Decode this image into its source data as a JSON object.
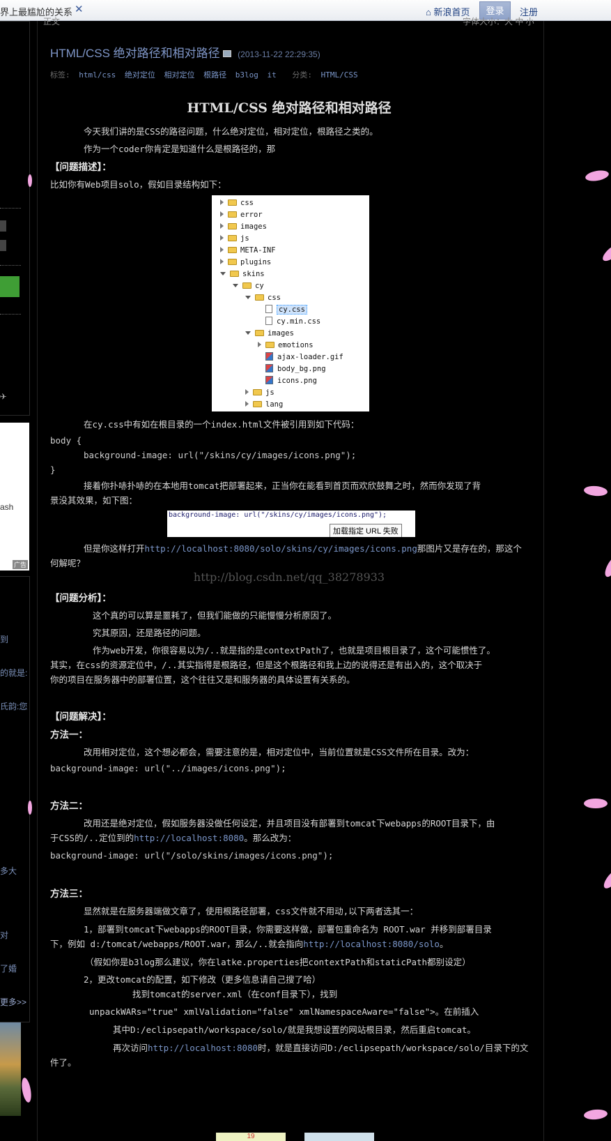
{
  "topbar": {
    "tab_title": "界上最尴尬的关系",
    "close": "✕",
    "home": "新浪首页",
    "login": "登录",
    "register": "注册"
  },
  "sidebar": {
    "ad_text": "ash",
    "ad_badge": "广告",
    "snippets": [
      "到",
      "的就是:",
      "氏韵:您",
      "多大",
      "对",
      "了婚",
      "更多>>"
    ]
  },
  "header_fragment": {
    "left": "正文",
    "right": "字体大小：大 中 小"
  },
  "post": {
    "title": "HTML/CSS 绝对路径和相对路径",
    "date": "(2013-11-22 22:29:35)",
    "tags_label": "标签:",
    "tags": [
      "html/css",
      "绝对定位",
      "相对定位",
      "根路径",
      "b3log",
      "it"
    ],
    "category_label": "分类:",
    "category": "HTML/CSS"
  },
  "article": {
    "heading": "HTML/CSS 绝对路径和相对路径",
    "p1": "今天我们讲的是CSS的路径问题，什么绝对定位，相对定位，根路径之类的。",
    "p2": "作为一个coder你肯定是知道什么是根路径的，那",
    "h_desc": "【问题描述】：",
    "p3": "比如你有Web项目solo，假如目录结构如下：",
    "p4": "在cy.css中有如在根目录的一个index.html文件被引用到如下代码：",
    "code1": "body {",
    "code2": "background-image: url(\"/skins/cy/images/icons.png\");",
    "code3": "}",
    "p5a": "接着你扑哧扑哧的在本地用tomcat把部署起来，正当你在能看到首页而欢欣鼓舞之时，然而你发现了背",
    "p5b": "景没其效果，如下图：",
    "p6a_pre": "但是你这样打开",
    "p6a_link": "http://localhost:8080/solo/skins/cy/images/icons.png",
    "p6a_post": "那图片又是存在的，那这个",
    "p6b": "何解呢？",
    "watermark": "http://blog.csdn.net/qq_38278933",
    "h_anal": "【问题分析】：",
    "p7": "这个真的可以算是噩耗了，但我们能做的只能慢慢分析原因了。",
    "p8": "究其原因，还是路径的问题。",
    "p9a": "作为web开发，你很容易以为/..就是指的是contextPath了，也就是项目根目录了，这个可能惯性了。",
    "p9b": "其实，在css的资源定位中，/..其实指得是根路径，但是这个根路径和我上边的说得还是有出入的，这个取决于",
    "p9c": "你的项目在服务器中的部署位置，这个往往又是和服务器的具体设置有关系的。",
    "h_sol": "【问题解决】：",
    "m1": "方法一：",
    "m1p": "改用相对定位，这个想必都会，需要注意的是，相对定位中，当前位置就是CSS文件所在目录。改为：",
    "m1c": "background-image: url(\"../images/icons.png\");",
    "m2": "方法二：",
    "m2pa": "改用还是绝对定位，假如服务器没做任何设定，并且项目没有部署到tomcat下webapps的ROOT目录下，由",
    "m2pb_pre": "于CSS的/..定位到的",
    "m2pb_link": "http://localhost:8080",
    "m2pb_post": "。那么改为：",
    "m2c": "background-image: url(\"/solo/skins/images/icons.png\");",
    "m3": "方法三：",
    "m3p": "显然就是在服务器端做文章了，使用根路径部署，css文件就不用动,以下两者选其一：",
    "m3a1": "1，部署到tomcat下webapps的ROOT目录，你需要这样做，部署包重命名为 ROOT.war 并移到部署目录",
    "m3a2_pre": "下，例如 d:/tomcat/webapps/ROOT.war，那么/..就会指向",
    "m3a2_link": "http://localhost:8080/solo",
    "m3a2_post": "。",
    "m3a3": "（假如你是b3log那么建议，你在latke.properties把contextPath和staticPath都别设定）",
    "m3b1": "2，更改tomcat的配置，如下修改（更多信息请自己搜了哈）",
    "m3b2": "找到tomcat的server.xml（在conf目录下），找到",
    "m3b3": "unpackWARs=\"true\" xmlValidation=\"false\" xmlNamespaceAware=\"false\">。在前插入",
    "m3b4": "其中D:/eclipsepath/workspace/solo/就是我想设置的网站根目录，然后重启tomcat。",
    "m3b5_pre": "再次访问",
    "m3b5_link": "http://localhost:8080",
    "m3b5_post": "时，就是直接访问D:/eclipsepath/workspace/solo/目录下的文",
    "m3b6": "件了。",
    "bottom_count": "19"
  },
  "tree": [
    {
      "name": "css",
      "depth": 0,
      "kind": "folder",
      "exp": "closed"
    },
    {
      "name": "error",
      "depth": 0,
      "kind": "folder",
      "exp": "closed"
    },
    {
      "name": "images",
      "depth": 0,
      "kind": "folder",
      "exp": "closed"
    },
    {
      "name": "js",
      "depth": 0,
      "kind": "folder",
      "exp": "closed"
    },
    {
      "name": "META-INF",
      "depth": 0,
      "kind": "folder",
      "exp": "closed"
    },
    {
      "name": "plugins",
      "depth": 0,
      "kind": "folder",
      "exp": "closed"
    },
    {
      "name": "skins",
      "depth": 0,
      "kind": "folder",
      "exp": "open"
    },
    {
      "name": "cy",
      "depth": 1,
      "kind": "folder",
      "exp": "open"
    },
    {
      "name": "css",
      "depth": 2,
      "kind": "folder",
      "exp": "open"
    },
    {
      "name": "cy.css",
      "depth": 3,
      "kind": "file",
      "exp": "none",
      "selected": true
    },
    {
      "name": "cy.min.css",
      "depth": 3,
      "kind": "file",
      "exp": "none"
    },
    {
      "name": "images",
      "depth": 2,
      "kind": "folder",
      "exp": "open"
    },
    {
      "name": "emotions",
      "depth": 3,
      "kind": "folder",
      "exp": "closed"
    },
    {
      "name": "ajax-loader.gif",
      "depth": 3,
      "kind": "image",
      "exp": "none"
    },
    {
      "name": "body_bg.png",
      "depth": 3,
      "kind": "image",
      "exp": "none"
    },
    {
      "name": "icons.png",
      "depth": 3,
      "kind": "image",
      "exp": "none"
    },
    {
      "name": "js",
      "depth": 2,
      "kind": "folder",
      "exp": "closed"
    },
    {
      "name": "lang",
      "depth": 2,
      "kind": "folder",
      "exp": "closed"
    }
  ],
  "shot2": {
    "code": "background-image: url(\"/skins/cy/images/icons.png\");",
    "tooltip": "加载指定 URL 失败"
  },
  "colors": {
    "link": "#7b96c9",
    "petal": "#f2a6e0",
    "background": "#000000"
  }
}
